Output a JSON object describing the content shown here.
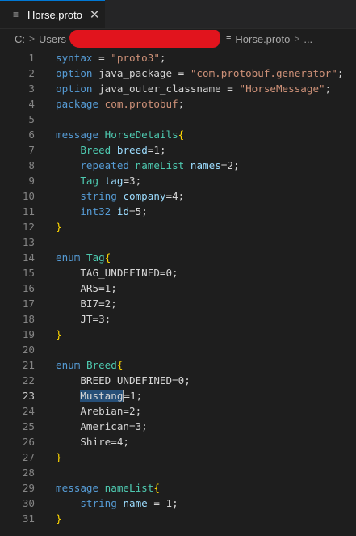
{
  "tab": {
    "icon": "lines-file-icon",
    "title": "Horse.proto",
    "close_icon": "close-icon"
  },
  "breadcrumb": {
    "drive": "C:",
    "users": "Users",
    "file_icon": "lines-file-icon",
    "file": "Horse.proto",
    "more": "..."
  },
  "colors": {
    "keyword": "#569cd6",
    "string": "#ce9178",
    "type": "#4ec9b0",
    "identifier": "#9cdcfe",
    "bracket": "#ffd700",
    "text": "#d4d4d4",
    "line_number": "#858585",
    "selection": "#264f78",
    "tab_accent": "#0078d4",
    "redaction": "#e1141d"
  },
  "editor": {
    "active_line": 23,
    "selected_text": "Mustang",
    "lines": [
      {
        "n": "1",
        "tokens": [
          {
            "t": "kw",
            "v": "syntax"
          },
          {
            "t": "tx",
            "v": " = "
          },
          {
            "t": "str",
            "v": "\"proto3\""
          },
          {
            "t": "tx",
            "v": ";"
          }
        ]
      },
      {
        "n": "2",
        "tokens": [
          {
            "t": "kw",
            "v": "option"
          },
          {
            "t": "tx",
            "v": " java_package = "
          },
          {
            "t": "str",
            "v": "\"com.protobuf.generator\""
          },
          {
            "t": "tx",
            "v": ";"
          }
        ]
      },
      {
        "n": "3",
        "tokens": [
          {
            "t": "kw",
            "v": "option"
          },
          {
            "t": "tx",
            "v": " java_outer_classname = "
          },
          {
            "t": "str",
            "v": "\"HorseMessage\""
          },
          {
            "t": "tx",
            "v": ";"
          }
        ]
      },
      {
        "n": "4",
        "tokens": [
          {
            "t": "kw",
            "v": "package"
          },
          {
            "t": "tx",
            "v": " "
          },
          {
            "t": "str",
            "v": "com.protobuf"
          },
          {
            "t": "tx",
            "v": ";"
          }
        ]
      },
      {
        "n": "5",
        "tokens": []
      },
      {
        "n": "6",
        "tokens": [
          {
            "t": "kw",
            "v": "message"
          },
          {
            "t": "tx",
            "v": " "
          },
          {
            "t": "ty",
            "v": "HorseDetails"
          },
          {
            "t": "br",
            "v": "{"
          }
        ]
      },
      {
        "n": "7",
        "tokens": [
          {
            "t": "tx",
            "v": "    "
          },
          {
            "t": "ty",
            "v": "Breed"
          },
          {
            "t": "tx",
            "v": " "
          },
          {
            "t": "id",
            "v": "breed"
          },
          {
            "t": "tx",
            "v": "=1;"
          }
        ]
      },
      {
        "n": "8",
        "tokens": [
          {
            "t": "tx",
            "v": "    "
          },
          {
            "t": "kw",
            "v": "repeated"
          },
          {
            "t": "tx",
            "v": " "
          },
          {
            "t": "ty",
            "v": "nameList"
          },
          {
            "t": "tx",
            "v": " "
          },
          {
            "t": "id",
            "v": "names"
          },
          {
            "t": "tx",
            "v": "=2;"
          }
        ]
      },
      {
        "n": "9",
        "tokens": [
          {
            "t": "tx",
            "v": "    "
          },
          {
            "t": "ty",
            "v": "Tag"
          },
          {
            "t": "tx",
            "v": " "
          },
          {
            "t": "id",
            "v": "tag"
          },
          {
            "t": "tx",
            "v": "=3;"
          }
        ]
      },
      {
        "n": "10",
        "tokens": [
          {
            "t": "tx",
            "v": "    "
          },
          {
            "t": "kw",
            "v": "string"
          },
          {
            "t": "tx",
            "v": " "
          },
          {
            "t": "id",
            "v": "company"
          },
          {
            "t": "tx",
            "v": "=4;"
          }
        ]
      },
      {
        "n": "11",
        "tokens": [
          {
            "t": "tx",
            "v": "    "
          },
          {
            "t": "kw",
            "v": "int32"
          },
          {
            "t": "tx",
            "v": " "
          },
          {
            "t": "id",
            "v": "id"
          },
          {
            "t": "tx",
            "v": "=5;"
          }
        ]
      },
      {
        "n": "12",
        "tokens": [
          {
            "t": "br",
            "v": "}"
          }
        ]
      },
      {
        "n": "13",
        "tokens": []
      },
      {
        "n": "14",
        "tokens": [
          {
            "t": "kw",
            "v": "enum"
          },
          {
            "t": "tx",
            "v": " "
          },
          {
            "t": "ty",
            "v": "Tag"
          },
          {
            "t": "br",
            "v": "{"
          }
        ]
      },
      {
        "n": "15",
        "tokens": [
          {
            "t": "tx",
            "v": "    TAG_UNDEFINED=0;"
          }
        ]
      },
      {
        "n": "16",
        "tokens": [
          {
            "t": "tx",
            "v": "    AR5=1;"
          }
        ]
      },
      {
        "n": "17",
        "tokens": [
          {
            "t": "tx",
            "v": "    BI7=2;"
          }
        ]
      },
      {
        "n": "18",
        "tokens": [
          {
            "t": "tx",
            "v": "    JT=3;"
          }
        ]
      },
      {
        "n": "19",
        "tokens": [
          {
            "t": "br",
            "v": "}"
          }
        ]
      },
      {
        "n": "20",
        "tokens": []
      },
      {
        "n": "21",
        "tokens": [
          {
            "t": "kw",
            "v": "enum"
          },
          {
            "t": "tx",
            "v": " "
          },
          {
            "t": "ty",
            "v": "Breed"
          },
          {
            "t": "br",
            "v": "{"
          }
        ]
      },
      {
        "n": "22",
        "tokens": [
          {
            "t": "tx",
            "v": "    BREED_UNDEFINED=0;"
          }
        ]
      },
      {
        "n": "23",
        "tokens": [
          {
            "t": "tx",
            "v": "    "
          },
          {
            "t": "sel",
            "v": "Mustang"
          },
          {
            "t": "cur",
            "v": ""
          },
          {
            "t": "tx",
            "v": "=1;"
          }
        ]
      },
      {
        "n": "24",
        "tokens": [
          {
            "t": "tx",
            "v": "    Arebian=2;"
          }
        ]
      },
      {
        "n": "25",
        "tokens": [
          {
            "t": "tx",
            "v": "    American=3;"
          }
        ]
      },
      {
        "n": "26",
        "tokens": [
          {
            "t": "tx",
            "v": "    Shire=4;"
          }
        ]
      },
      {
        "n": "27",
        "tokens": [
          {
            "t": "br",
            "v": "}"
          }
        ]
      },
      {
        "n": "28",
        "tokens": []
      },
      {
        "n": "29",
        "tokens": [
          {
            "t": "kw",
            "v": "message"
          },
          {
            "t": "tx",
            "v": " "
          },
          {
            "t": "ty",
            "v": "nameList"
          },
          {
            "t": "br",
            "v": "{"
          }
        ]
      },
      {
        "n": "30",
        "tokens": [
          {
            "t": "tx",
            "v": "    "
          },
          {
            "t": "kw",
            "v": "string"
          },
          {
            "t": "tx",
            "v": " "
          },
          {
            "t": "id",
            "v": "name"
          },
          {
            "t": "tx",
            "v": " = 1;"
          }
        ]
      },
      {
        "n": "31",
        "tokens": [
          {
            "t": "br",
            "v": "}"
          }
        ]
      }
    ]
  }
}
